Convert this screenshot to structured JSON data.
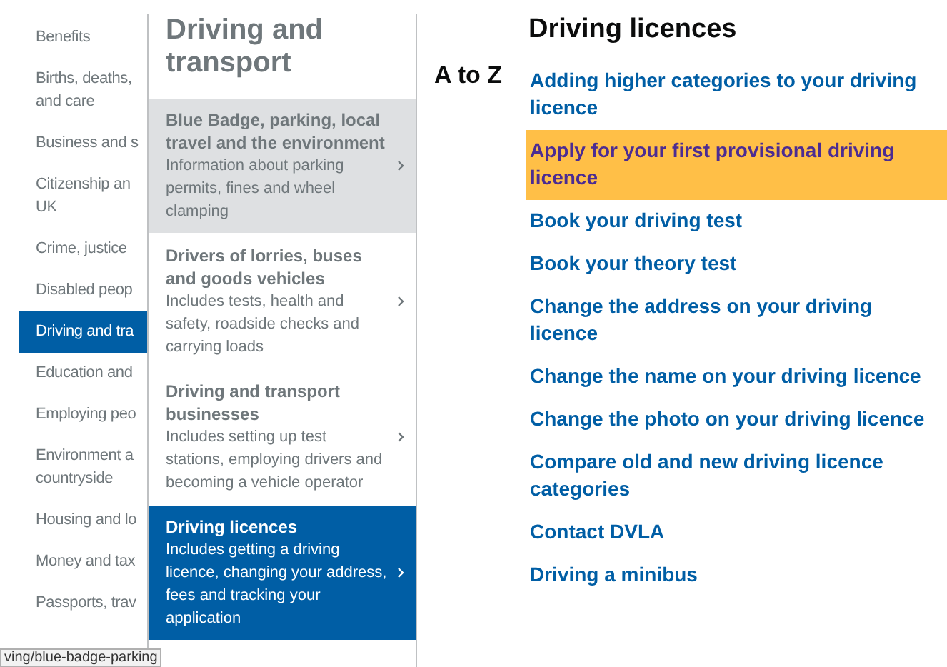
{
  "sidebar": {
    "items": [
      {
        "lines": [
          "Benefits"
        ],
        "selected": false
      },
      {
        "lines": [
          "Births, deaths,",
          "and care"
        ],
        "selected": false
      },
      {
        "lines": [
          "Business and s"
        ],
        "selected": false
      },
      {
        "lines": [
          "Citizenship an",
          "UK"
        ],
        "selected": false
      },
      {
        "lines": [
          "Crime, justice"
        ],
        "selected": false
      },
      {
        "lines": [
          "Disabled peop"
        ],
        "selected": false
      },
      {
        "lines": [
          "Driving and tra"
        ],
        "selected": true
      },
      {
        "lines": [
          "Education and"
        ],
        "selected": false
      },
      {
        "lines": [
          "Employing peo"
        ],
        "selected": false
      },
      {
        "lines": [
          "Environment a",
          "countryside"
        ],
        "selected": false
      },
      {
        "lines": [
          "Housing and lo"
        ],
        "selected": false
      },
      {
        "lines": [
          "Money and tax"
        ],
        "selected": false
      },
      {
        "lines": [
          "Passports, trav"
        ],
        "selected": false
      }
    ]
  },
  "subnav": {
    "title": "Driving and transport",
    "items": [
      {
        "title": "Blue Badge, parking, local travel and the environment",
        "description": "Information about parking permits, fines and wheel clamping",
        "hovered": true,
        "selected": false
      },
      {
        "title": "Drivers of lorries, buses and goods vehicles",
        "description": "Includes tests, health and safety, roadside checks and carrying loads",
        "hovered": false,
        "selected": false
      },
      {
        "title": "Driving and transport businesses",
        "description": "Includes setting up test stations, employing drivers and becoming a vehicle operator",
        "hovered": false,
        "selected": false
      },
      {
        "title": "Driving licences",
        "description": "Includes getting a driving licence, changing your address, fees and tracking your application",
        "hovered": false,
        "selected": true
      }
    ]
  },
  "content": {
    "title": "Driving licences",
    "index_label": "A to Z",
    "links": [
      {
        "text": "Adding higher categories to your driving licence",
        "focused": false
      },
      {
        "text": "Apply for your first provisional driving licence",
        "focused": true
      },
      {
        "text": "Book your driving test",
        "focused": false
      },
      {
        "text": "Book your theory test",
        "focused": false
      },
      {
        "text": "Change the address on your driving licence",
        "focused": false
      },
      {
        "text": "Change the name on your driving licence",
        "focused": false
      },
      {
        "text": "Change the photo on your driving licence",
        "focused": false
      },
      {
        "text": "Compare old and new driving licence categories",
        "focused": false
      },
      {
        "text": "Contact DVLA",
        "focused": false
      },
      {
        "text": "Driving a minibus",
        "focused": false
      }
    ]
  },
  "status_bar": {
    "url": "ving/blue-badge-parking"
  }
}
